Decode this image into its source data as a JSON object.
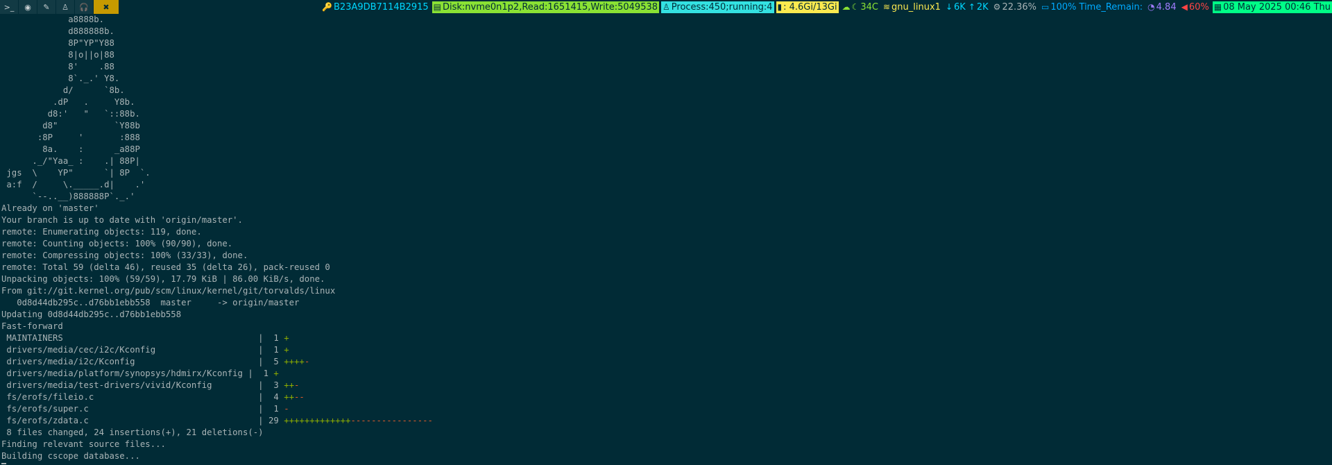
{
  "topbar": {
    "tags": [
      {
        "name": "terminal-icon",
        "glyph": ">_"
      },
      {
        "name": "app-icon",
        "glyph": "◉"
      },
      {
        "name": "pen-icon",
        "glyph": "✎"
      },
      {
        "name": "linux-icon",
        "glyph": "♙"
      },
      {
        "name": "headphones-icon",
        "glyph": "🎧"
      },
      {
        "name": "tools-icon",
        "glyph": "✖"
      }
    ],
    "status": {
      "key": "B23A9DB7114B2915",
      "disk": "Disk:nvme0n1p2,Read:1651415,Write:5049538",
      "process": "Process:450;running:4",
      "memory": ": 4.6Gi/13Gi",
      "temp": "34C",
      "wifi": "gnu_linux1",
      "down": "6K",
      "up": "2K",
      "cpu": "22.36%",
      "battery": "100%",
      "time_remain": "Time_Remain:",
      "load": "4.84",
      "volume": "60%",
      "datetime": "08 May 2025 00:46 Thu"
    },
    "colors": {
      "key": "#00d7ff",
      "disk_bg": "#8ae234",
      "process_bg": "#34e2e2",
      "memory_bg": "#fce94f",
      "temp": "#8ae234",
      "wifi": "#fce94f",
      "net": "#00d7ff",
      "cpu": "#aab4b6",
      "battery": "#00aaff",
      "load": "#a07cff",
      "volume": "#ff4444",
      "date_bg": "#00ff87"
    }
  },
  "terminal": {
    "ascii_art": [
      "             a8888b.",
      "             d888888b.",
      "             8P\"YP\"Y88",
      "             8|o||o|88",
      "             8'    .88",
      "             8`._.' Y8.",
      "            d/      `8b.",
      "          .dP   .     Y8b.",
      "         d8:'   \"   `::88b.",
      "        d8\"           `Y88b",
      "       :8P     '       :888",
      "        8a.    :      _a88P",
      "      ._/\"Yaa_ :    .| 88P|",
      " jgs  \\    YP\"      `| 8P  `.",
      " a:f  /     \\._____.d|    .'",
      "      `--..__)888888P`._.'"
    ],
    "output_before": [
      "Already on 'master'",
      "Your branch is up to date with 'origin/master'.",
      "remote: Enumerating objects: 119, done.",
      "remote: Counting objects: 100% (90/90), done.",
      "remote: Compressing objects: 100% (33/33), done.",
      "remote: Total 59 (delta 46), reused 35 (delta 26), pack-reused 0",
      "Unpacking objects: 100% (59/59), 17.79 KiB | 86.00 KiB/s, done.",
      "From git://git.kernel.org/pub/scm/linux/kernel/git/torvalds/linux",
      "   0d8d44db295c..d76bb1ebb558  master     -> origin/master",
      "Updating 0d8d44db295c..d76bb1ebb558",
      "Fast-forward"
    ],
    "diffstat": [
      {
        "file": " MAINTAINERS                                      ",
        "count": "  1 ",
        "plus": "+",
        "minus": ""
      },
      {
        "file": " drivers/media/cec/i2c/Kconfig                    ",
        "count": "  1 ",
        "plus": "+",
        "minus": ""
      },
      {
        "file": " drivers/media/i2c/Kconfig                        ",
        "count": "  5 ",
        "plus": "++++",
        "minus": "-"
      },
      {
        "file": " drivers/media/platform/synopsys/hdmirx/Kconfig ",
        "count": "  1 ",
        "plus": "+",
        "minus": ""
      },
      {
        "file": " drivers/media/test-drivers/vivid/Kconfig         ",
        "count": "  3 ",
        "plus": "++",
        "minus": "-"
      },
      {
        "file": " fs/erofs/fileio.c                                ",
        "count": "  4 ",
        "plus": "++",
        "minus": "--"
      },
      {
        "file": " fs/erofs/super.c                                 ",
        "count": "  1 ",
        "plus": "",
        "minus": "-"
      },
      {
        "file": " fs/erofs/zdata.c                                 ",
        "count": " 29 ",
        "plus": "+++++++++++++",
        "minus": "----------------"
      }
    ],
    "output_after": [
      " 8 files changed, 24 insertions(+), 21 deletions(-)",
      "Finding relevant source files...",
      "Building cscope database..."
    ]
  }
}
